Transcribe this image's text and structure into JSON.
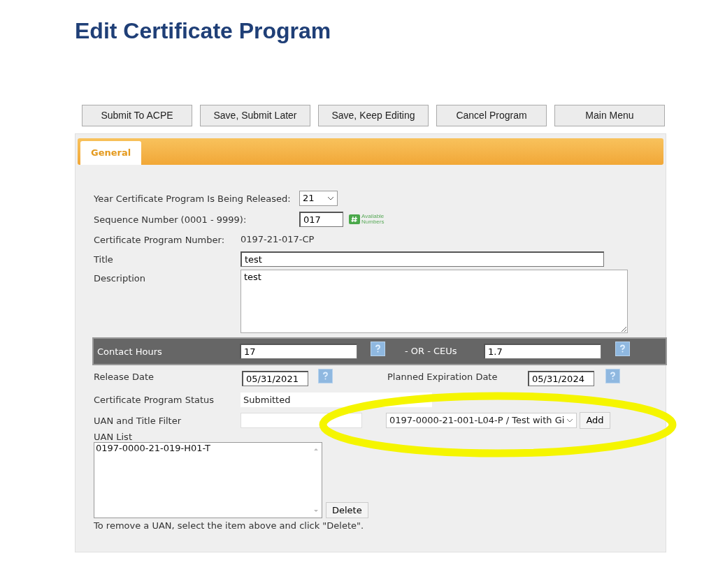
{
  "page_title": "Edit Certificate Program",
  "buttons": [
    "Submit To ACPE",
    "Save, Submit Later",
    "Save, Keep Editing",
    "Cancel Program",
    "Main Menu"
  ],
  "tabs": [
    {
      "label": "General",
      "selected": true
    }
  ],
  "form": {
    "year": {
      "label": "Year Certificate Program Is Being Released:",
      "value": "21"
    },
    "sequence": {
      "label": "Sequence Number (0001 - 9999):",
      "value": "017",
      "link_line1": "Available",
      "link_line2": "Numbers"
    },
    "program_number": {
      "label": "Certificate Program Number:",
      "value": "0197-21-017-CP"
    },
    "title": {
      "label": "Title",
      "value": "test"
    },
    "description": {
      "label": "Description",
      "value": "test"
    },
    "contact_hours": {
      "label": "Contact Hours",
      "value": "17"
    },
    "ceus": {
      "label": "- OR - CEUs",
      "value": "1.7"
    },
    "release_date": {
      "label": "Release Date",
      "value": "05/31/2021"
    },
    "expiration_date": {
      "label": "Planned Expiration Date",
      "value": "05/31/2024"
    },
    "status": {
      "label": "Certificate Program Status",
      "value": "Submitted"
    },
    "uan_filter": {
      "label": "UAN and Title Filter"
    },
    "uan_select": {
      "value": "0197-0000-21-001-L04-P / Test with Gi",
      "button": "Add"
    },
    "uan_list": {
      "label": "UAN List",
      "items": [
        {
          "text": "0197-0000-21-019-H01-T",
          "selected": false
        }
      ],
      "button": "Delete"
    },
    "note": "To remove a UAN, select the item above and click \"Delete\"."
  },
  "annotation": {
    "kind": "ellipse",
    "color": "#f5f500"
  }
}
